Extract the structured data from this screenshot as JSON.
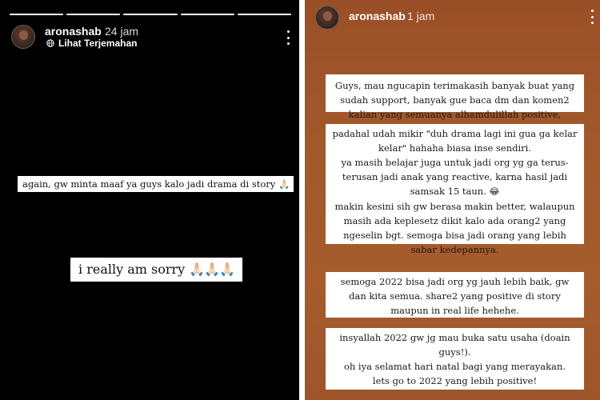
{
  "left_story": {
    "username": "aronashab",
    "time": "24 jam",
    "translate_label": "Lihat Terjemahan",
    "captions": {
      "apology_text": "again, gw minta maaf ya guys kalo jadi drama di story",
      "apology_emoji": "🙏🏻",
      "sorry_text": "i really am sorry",
      "sorry_emoji": "🙏🏻🙏🏻🙏🏻"
    }
  },
  "right_story": {
    "username": "aronashab",
    "time": "1 jam",
    "box1": [
      "Guys, mau ngucapin terimakasih banyak buat yang",
      "sudah support, banyak gue baca dm dan komen2",
      "kalian yang semuanya alhamdulillah positive,"
    ],
    "box2": [
      "padahal udah mikir \"duh drama lagi ini gua ga kelar",
      "kelar\" hahaha biasa inse sendiri.",
      "ya masih belajar juga untuk jadi org yg ga terus-",
      "terusan jadi anak yang reactive, karna hasil jadi",
      "samsak 15 taun.",
      "makin kesini sih gw berasa makin better, walaupun",
      "masih ada keplesetz dikit kalo ada orang2 yang",
      "ngeselin bgt. semoga bisa jadi orang yang lebih",
      "sabar kedepannya."
    ],
    "box2_emoji": "😂",
    "box3": [
      "semoga 2022 bisa jadi org yg jauh lebih baik, gw",
      "dan kita semua. share2 yang positive di story",
      "maupun in real life hehehe."
    ],
    "box4": [
      "insyallah 2022 gw jg mau buka satu usaha (doain",
      "guys!).",
      "oh iya selamat hari natal bagi yang merayakan.",
      "lets go to 2022 yang lebih positive!"
    ]
  },
  "icons": {
    "more": "more-vertical-icon",
    "translate": "globe-icon",
    "avatar": "profile-avatar"
  },
  "colors": {
    "left_background": "#000000",
    "right_background": "#a1592b",
    "caption_background": "#ffffff"
  }
}
